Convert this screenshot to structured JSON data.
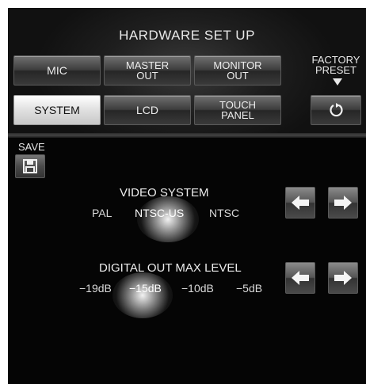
{
  "header": {
    "title": "HARDWARE SET UP"
  },
  "tabs": [
    {
      "label1": "MIC",
      "label2": ""
    },
    {
      "label1": "MASTER",
      "label2": "OUT"
    },
    {
      "label1": "MONITOR",
      "label2": "OUT"
    },
    {
      "label1": "SYSTEM",
      "label2": ""
    },
    {
      "label1": "LCD",
      "label2": ""
    },
    {
      "label1": "TOUCH",
      "label2": "PANEL"
    }
  ],
  "selected_tab": "SYSTEM",
  "factory_preset": {
    "label1": "FACTORY",
    "label2": "PRESET",
    "icon": "reset-icon"
  },
  "save": {
    "label": "SAVE",
    "icon": "floppy-disk-icon"
  },
  "video_system": {
    "title": "VIDEO SYSTEM",
    "options": [
      "PAL",
      "NTSC-US",
      "NTSC"
    ],
    "selected": "NTSC-US"
  },
  "digital_out": {
    "title": "DIGITAL OUT MAX LEVEL",
    "options": [
      "−19dB",
      "−15dB",
      "−10dB",
      "−5dB"
    ],
    "selected": "−15dB"
  },
  "colors": {
    "background": "#050505",
    "text": "#e8e8e8",
    "selected_button": "#ffffff"
  }
}
